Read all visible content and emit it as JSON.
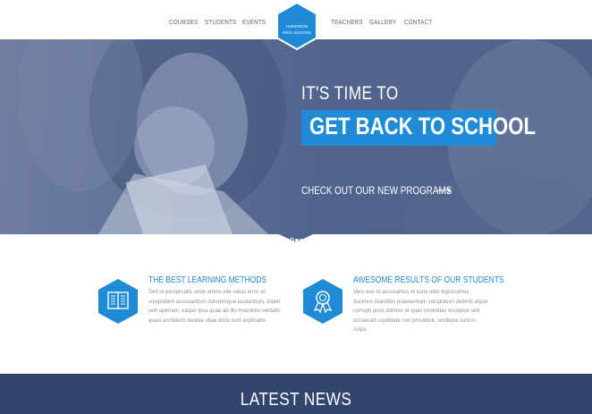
{
  "nav": {
    "items": [
      "COURSES",
      "STUDENTS",
      "EVENTS",
      "TEACHERS",
      "GALLERY",
      "CONTACT"
    ],
    "logo_line1": "HARRISON",
    "logo_line2": "HIGH SCHOOL",
    "logo_icon": "graduation-cap-icon"
  },
  "hero": {
    "line1": "IT'S TIME TO",
    "line2": "GET BACK TO SCHOOL",
    "cta": "CHECK OUT OUR NEW PROGRAMS",
    "slides_total": 3,
    "slide_active": 1
  },
  "features": [
    {
      "icon": "book-icon",
      "title": "THE BEST LEARNING METHODS",
      "lines": [
        "Sed ut perspiciatis unde omnis iste natus error sit",
        "voluptatem accusantium doloremque laudantium, totam",
        "rem aperiam, eaque ipsa quae ab illo inventore veritatis",
        "quasi architecto beatae vitae dicta sunt explicabo."
      ]
    },
    {
      "icon": "award-ribbon-icon",
      "title": "AWESOME RESULTS OF OUR STUDENTS",
      "lines": [
        "Vero eos et accusamus et iusto odio dignissimos",
        "ducimus blanditiis praesentium voluptatum deleniti atque",
        "corrupti quos dolores et quas molestias excepturi sint",
        "occaecati cupiditate non provident, similique sunt in",
        "culpa."
      ]
    }
  ],
  "news": {
    "title": "LATEST NEWS"
  },
  "colors": {
    "accent": "#1f8ad6",
    "hero_overlay": "#51648d",
    "news_bg": "#32456c"
  }
}
